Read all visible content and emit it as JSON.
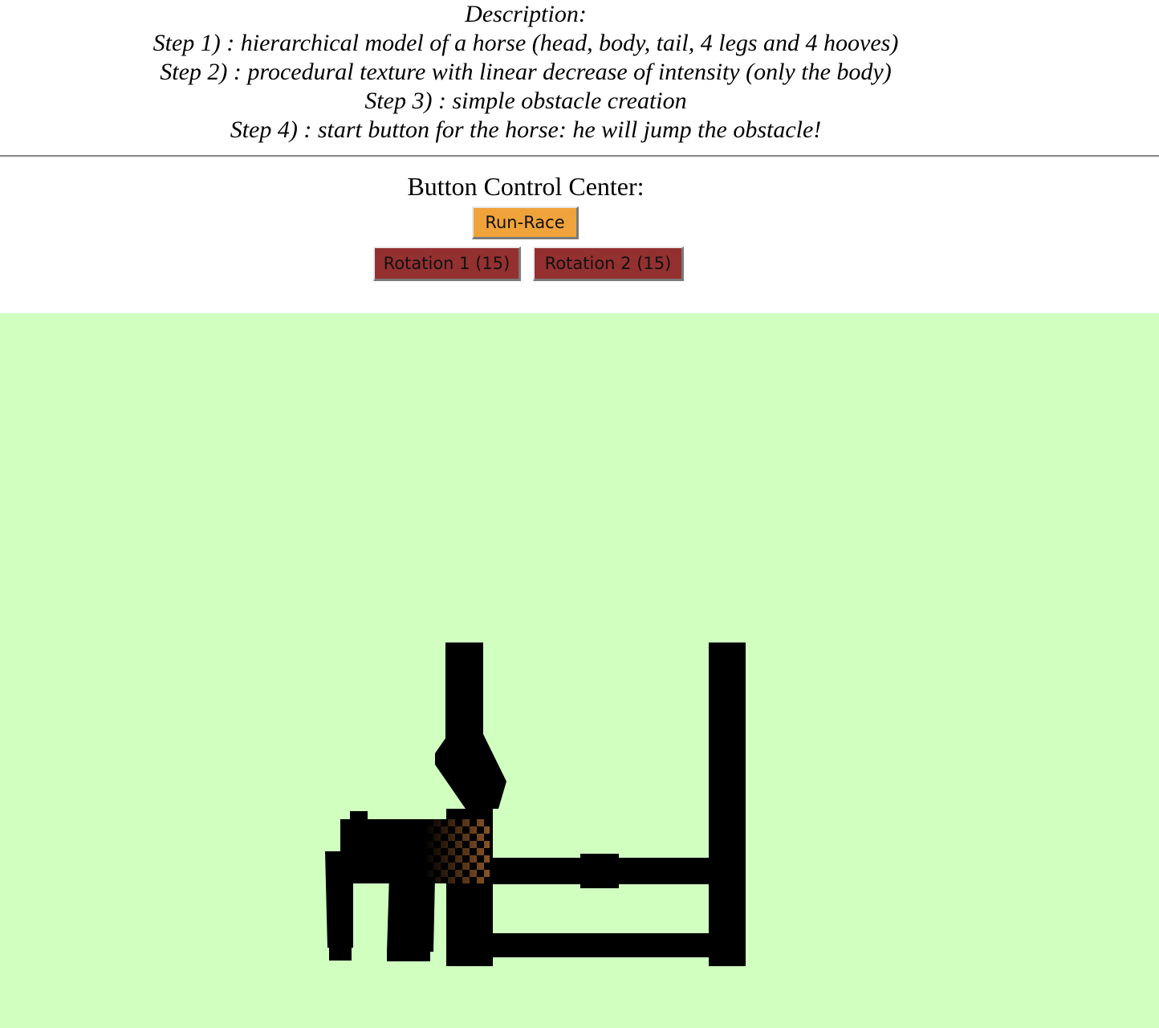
{
  "description": {
    "heading": "Description:",
    "steps": [
      "Step 1) : hierarchical model of a horse (head, body, tail, 4 legs and 4 hooves)",
      "Step 2) : procedural texture with linear decrease of intensity (only the body)",
      "Step 3) : simple obstacle creation",
      "Step 4) : start button for the horse: he will jump the obstacle!"
    ]
  },
  "controls": {
    "title": "Button Control Center:",
    "run_label": "Run-Race",
    "rotation1_label": "Rotation 1 (15)",
    "rotation2_label": "Rotation 2 (15)"
  },
  "colors": {
    "canvas_background": "#d0ffc0",
    "run_button": "#f0a33b",
    "rotation_button": "#943030",
    "silhouette": "#000000",
    "texture_brown": "#7a4a20"
  }
}
